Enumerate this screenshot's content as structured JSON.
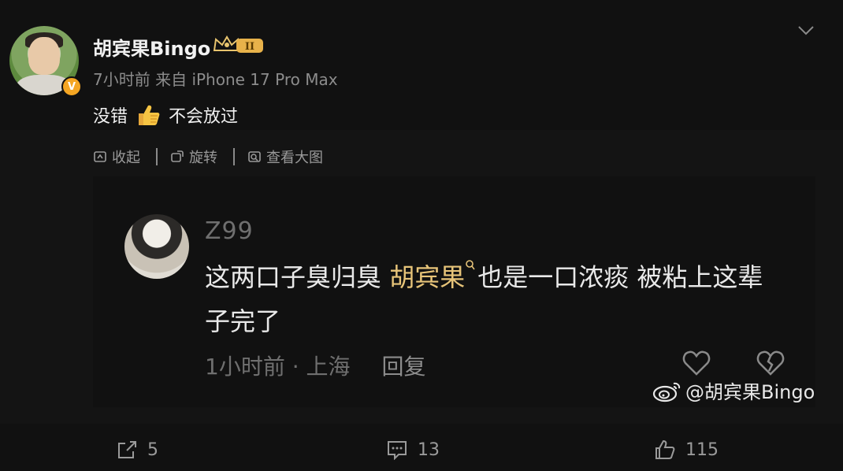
{
  "post": {
    "username": "胡宾果Bingo",
    "level_badge": "II",
    "meta": "7小时前 来自 iPhone 17 Pro Max",
    "text_before": "没错",
    "text_after": "不会放过",
    "verified_badge": "V"
  },
  "toolbar": {
    "collapse": "收起",
    "rotate": "旋转",
    "view_large": "查看大图"
  },
  "comment": {
    "name": "Z99",
    "text_part1": "这两口子臭归臭 ",
    "highlight": "胡宾果",
    "text_part2": "也是一口浓痰 被粘上这辈子完了",
    "time_location": "1小时前 · 上海",
    "reply": "回复"
  },
  "watermark": "@胡宾果Bingo",
  "actions": {
    "share_count": "5",
    "comment_count": "13",
    "like_count": "115"
  },
  "colors": {
    "background": "#141414",
    "highlight": "#e7c479",
    "verified": "#f5a623"
  }
}
